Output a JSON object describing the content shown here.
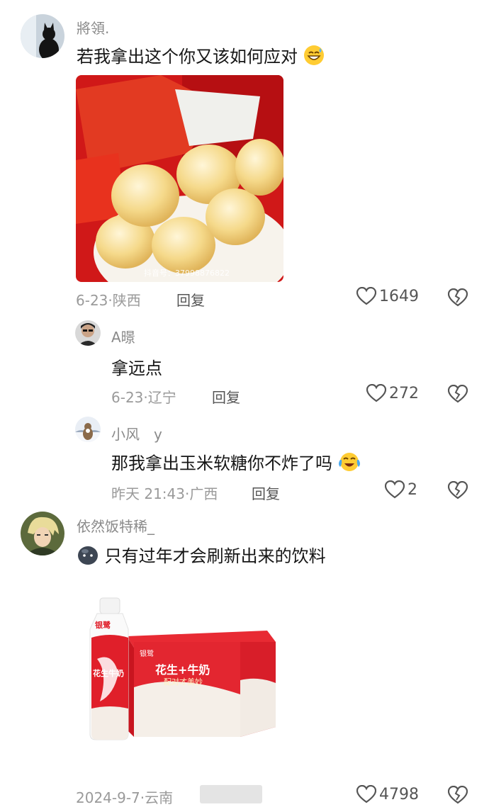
{
  "comments": [
    {
      "name": "將領.",
      "text": "若我拿出这个你又该如何应对",
      "image_watermark": "抖音号：37998876822",
      "meta": "6-23·陕西",
      "reply_label": "回复",
      "likes": "1649"
    },
    {
      "name": "A暻",
      "text": "拿远点",
      "meta": "6-23·辽宁",
      "reply_label": "回复",
      "likes": "272"
    },
    {
      "name": "小风　y",
      "text": "那我拿出玉米软糖你不炸了吗",
      "meta": "昨天 21:43·广西",
      "reply_label": "回复",
      "likes": "2"
    },
    {
      "name": "依然饭特稀_",
      "text": "只有过年才会刷新出来的饮料",
      "image_text": {
        "bottle_brand": "银鹭",
        "bottle_label": "花生牛奶",
        "box_brand": "银鹭",
        "box_title": "花生+牛奶",
        "box_subtitle": "配对才美妙"
      },
      "meta": "2024-9-7·云南",
      "likes": "4798"
    }
  ],
  "icons": {
    "like": "heart-outline-icon",
    "dislike": "broken-heart-icon"
  }
}
